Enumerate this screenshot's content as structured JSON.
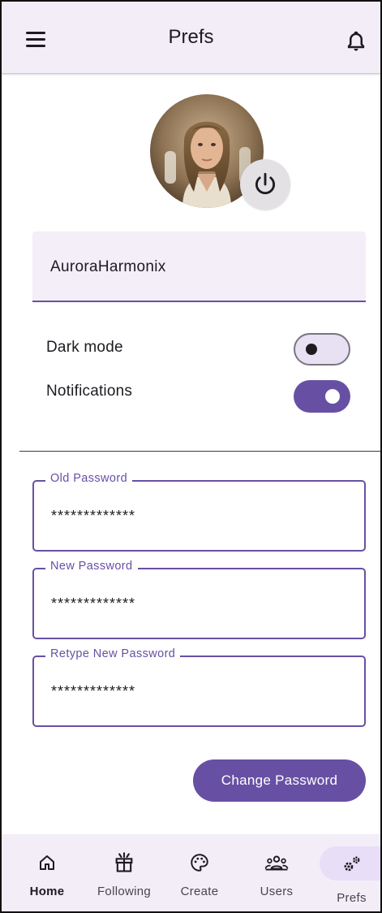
{
  "app": {
    "title": "Prefs"
  },
  "profile": {
    "username": "AuroraHarmonix"
  },
  "settings": {
    "dark_mode": {
      "label": "Dark mode",
      "enabled": false
    },
    "notifications": {
      "label": "Notifications",
      "enabled": true
    }
  },
  "passwords": {
    "old": {
      "label": "Old Password",
      "value": "*************"
    },
    "new": {
      "label": "New Password",
      "value": "*************"
    },
    "retype": {
      "label": "Retype New Password",
      "value": "*************"
    }
  },
  "change_password_button": "Change Password",
  "nav": {
    "items": [
      {
        "label": "Home",
        "icon": "home-icon",
        "selected": false
      },
      {
        "label": "Following",
        "icon": "gift-icon",
        "selected": false
      },
      {
        "label": "Create",
        "icon": "palette-icon",
        "selected": false
      },
      {
        "label": "Users",
        "icon": "groups-icon",
        "selected": false
      },
      {
        "label": "Prefs",
        "icon": "settings-gears-icon",
        "selected": true
      }
    ]
  },
  "colors": {
    "primary": "#6750a4",
    "surface_container": "#f2edf7",
    "secondary_container": "#e8def8"
  }
}
